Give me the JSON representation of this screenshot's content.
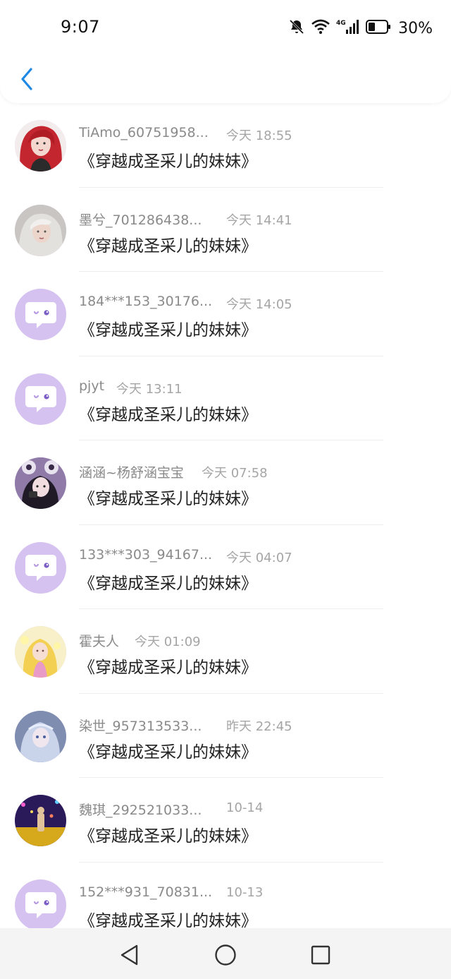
{
  "status_bar": {
    "time": "9:07",
    "battery": "30%",
    "icons": [
      "mute-bell-icon",
      "wifi-icon",
      "4g-signal-icon",
      "battery-icon"
    ]
  },
  "header": {
    "back_icon": "chevron-left-icon",
    "accent_color": "#1E88E5"
  },
  "items": [
    {
      "name": "TiAmo_60751958...",
      "time": "今天 18:55",
      "book": "《穿越成圣采儿的妹妹》",
      "avatar": "photo-red-hair"
    },
    {
      "name": "墨兮_701286438...",
      "time": "今天 14:41",
      "book": "《穿越成圣采儿的妹妹》",
      "avatar": "photo-silver-hair"
    },
    {
      "name": "184***153_30176...",
      "time": "今天 14:05",
      "book": "《穿越成圣采儿的妹妹》",
      "avatar": "default-chat-bubble"
    },
    {
      "name": "pjyt",
      "time": "今天 13:11",
      "book": "《穿越成圣采儿的妹妹》",
      "avatar": "default-chat-bubble"
    },
    {
      "name": "涵涵~杨舒涵宝宝",
      "time": "今天 07:58",
      "book": "《穿越成圣采儿的妹妹》",
      "avatar": "photo-girl-camera"
    },
    {
      "name": "133***303_94167...",
      "time": "今天 04:07",
      "book": "《穿越成圣采儿的妹妹》",
      "avatar": "default-chat-bubble"
    },
    {
      "name": "霍夫人",
      "time": "今天 01:09",
      "book": "《穿越成圣采儿的妹妹》",
      "avatar": "photo-yellow-girl"
    },
    {
      "name": "染世_957313533...",
      "time": "昨天 22:45",
      "book": "《穿越成圣采儿的妹妹》",
      "avatar": "photo-blue-girl"
    },
    {
      "name": "魏琪_292521033...",
      "time": "10-14",
      "book": "《穿越成圣采儿的妹妹》",
      "avatar": "photo-night-lights"
    },
    {
      "name": "152***931_70831...",
      "time": "10-13",
      "book": "《穿越成圣采儿的妹妹》",
      "avatar": "default-chat-bubble"
    }
  ],
  "navbar": {
    "icons": [
      "back-triangle-icon",
      "home-circle-icon",
      "recents-square-icon"
    ]
  }
}
